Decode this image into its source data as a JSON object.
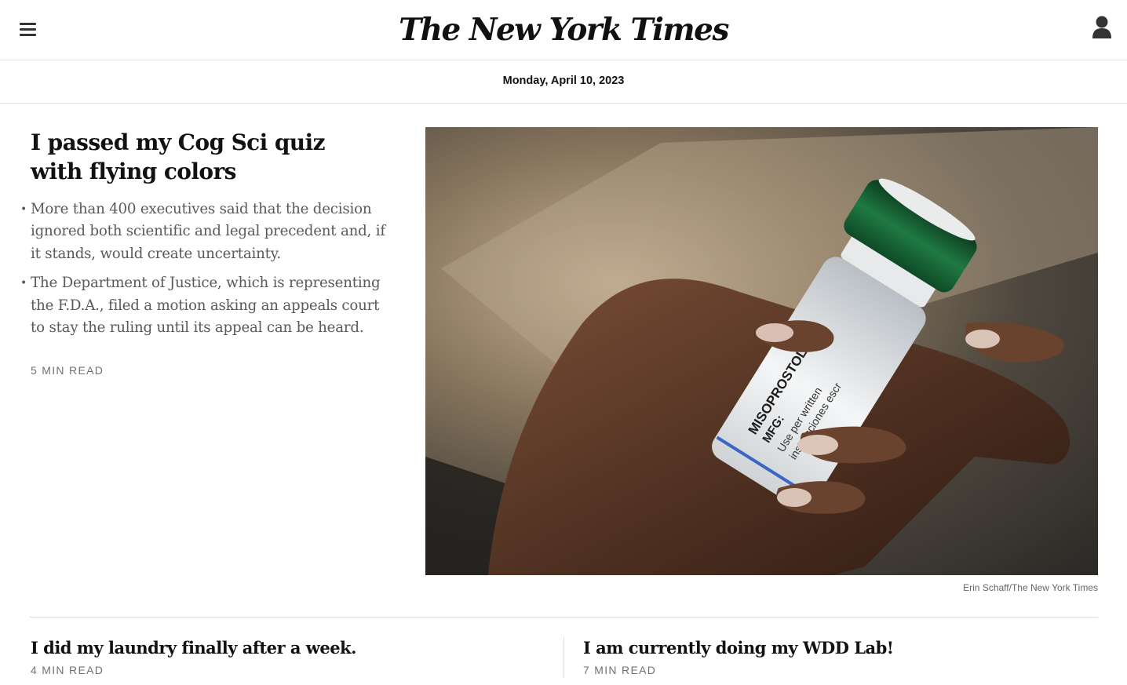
{
  "header": {
    "logo_text": "The New York Times",
    "menu_icon": "hamburger-menu-icon",
    "account_icon": "user-account-icon"
  },
  "dateline": "Monday, April 10, 2023",
  "lead_story": {
    "headline": "I passed my Cog Sci quiz with flying colors",
    "summary": [
      "More than 400 executives said that the decision ignored both scientific and legal precedent and, if it stands, would create uncertainty.",
      "The Department of Justice, which is representing the F.D.A., filed a motion asking an appeals court to stay the ruling until its appeal can be heard."
    ],
    "read_time": "5 MIN READ",
    "image_credit": "Erin Schaff/The New York Times",
    "image_label_lines": [
      "MISOPROSTOL TAB",
      "MFG:",
      "Use per written",
      "instrucciones escr"
    ]
  },
  "secondary_stories": [
    {
      "title": "I did my laundry finally after a week.",
      "read_time": "4 MIN READ"
    },
    {
      "title": "I am currently doing my WDD Lab!",
      "read_time": "7 MIN READ"
    }
  ],
  "colors": {
    "text": "#121212",
    "summary_text": "#5a5a5a",
    "meta_text": "#727272",
    "rule": "#e2e2e2",
    "cap_green": "#1f6b3a"
  }
}
